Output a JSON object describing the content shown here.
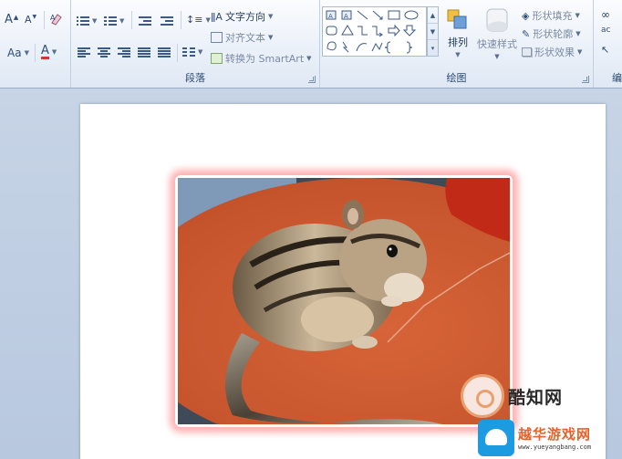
{
  "ribbon": {
    "font_group": {
      "grow_font": "A",
      "shrink_font": "A",
      "change_case": "Aa",
      "font_color": "A"
    },
    "paragraph_group": {
      "label": "段落",
      "text_direction": "文字方向",
      "align_text": "对齐文本",
      "convert_smartart": "转换为 SmartArt"
    },
    "drawing_group": {
      "label": "绘图",
      "arrange": "排列",
      "quick_styles": "快速样式",
      "shape_fill": "形状填充",
      "shape_outline": "形状轮廓",
      "shape_effects": "形状效果"
    },
    "editing_group": {
      "label": "编"
    }
  },
  "watermarks": {
    "site1": "酷知网",
    "site2_cn": "越华游戏网",
    "site2_url": "www.yueyangbang.com"
  },
  "colors": {
    "ribbon_bg": "#eef3fa",
    "workspace_bg": "#bccbe0",
    "photo_glow": "#ff9696",
    "table_orange": "#c8542c"
  }
}
